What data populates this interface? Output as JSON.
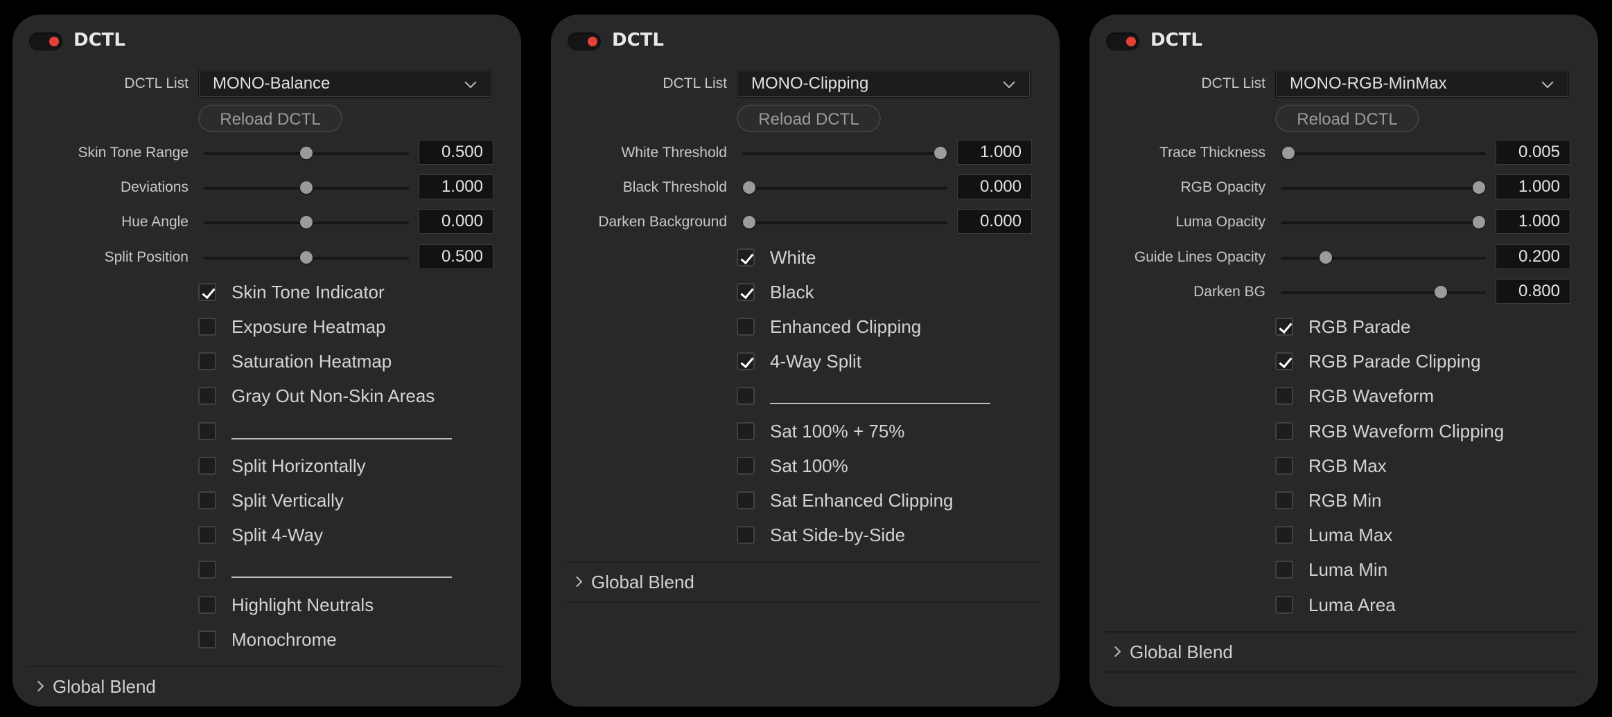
{
  "panels": [
    {
      "title": "DCTL",
      "dctl_list_label": "DCTL List",
      "dctl_list_value": "MONO-Balance",
      "reload_label": "Reload DCTL",
      "sliders": [
        {
          "label": "Skin Tone Range",
          "value": "0.500",
          "position": 0.5
        },
        {
          "label": "Deviations",
          "value": "1.000",
          "position": 0.5
        },
        {
          "label": "Hue Angle",
          "value": "0.000",
          "position": 0.5
        },
        {
          "label": "Split Position",
          "value": "0.500",
          "position": 0.5
        }
      ],
      "checkboxes": [
        {
          "label": "Skin Tone Indicator",
          "checked": true
        },
        {
          "label": "Exposure Heatmap",
          "checked": false
        },
        {
          "label": "Saturation Heatmap",
          "checked": false
        },
        {
          "label": "Gray Out Non-Skin Areas",
          "checked": false
        },
        {
          "label": "",
          "checked": false,
          "separator": true
        },
        {
          "label": "Split Horizontally",
          "checked": false
        },
        {
          "label": "Split Vertically",
          "checked": false
        },
        {
          "label": "Split 4-Way",
          "checked": false
        },
        {
          "label": "",
          "checked": false,
          "separator": true
        },
        {
          "label": "Highlight Neutrals",
          "checked": false
        },
        {
          "label": "Monochrome",
          "checked": false
        }
      ],
      "section_label": "Global Blend"
    },
    {
      "title": "DCTL",
      "dctl_list_label": "DCTL List",
      "dctl_list_value": "MONO-Clipping",
      "reload_label": "Reload DCTL",
      "sliders": [
        {
          "label": "White Threshold",
          "value": "1.000",
          "position": 1.0
        },
        {
          "label": "Black Threshold",
          "value": "0.000",
          "position": 0.0
        },
        {
          "label": "Darken Background",
          "value": "0.000",
          "position": 0.0
        }
      ],
      "checkboxes": [
        {
          "label": "White",
          "checked": true
        },
        {
          "label": "Black",
          "checked": true
        },
        {
          "label": "Enhanced Clipping",
          "checked": false
        },
        {
          "label": "4-Way Split",
          "checked": true
        },
        {
          "label": "",
          "checked": false,
          "separator": true
        },
        {
          "label": "Sat 100% + 75%",
          "checked": false
        },
        {
          "label": "Sat 100%",
          "checked": false
        },
        {
          "label": "Sat Enhanced Clipping",
          "checked": false
        },
        {
          "label": "Sat Side-by-Side",
          "checked": false
        }
      ],
      "section_label": "Global Blend"
    },
    {
      "title": "DCTL",
      "dctl_list_label": "DCTL List",
      "dctl_list_value": "MONO-RGB-MinMax",
      "reload_label": "Reload DCTL",
      "sliders": [
        {
          "label": "Trace Thickness",
          "value": "0.005",
          "position": 0.005
        },
        {
          "label": "RGB Opacity",
          "value": "1.000",
          "position": 1.0
        },
        {
          "label": "Luma Opacity",
          "value": "1.000",
          "position": 1.0
        },
        {
          "label": "Guide Lines Opacity",
          "value": "0.200",
          "position": 0.2
        },
        {
          "label": "Darken BG",
          "value": "0.800",
          "position": 0.8
        }
      ],
      "checkboxes": [
        {
          "label": "RGB Parade",
          "checked": true
        },
        {
          "label": "RGB Parade Clipping",
          "checked": true
        },
        {
          "label": "RGB Waveform",
          "checked": false
        },
        {
          "label": "RGB Waveform Clipping",
          "checked": false
        },
        {
          "label": "RGB Max",
          "checked": false
        },
        {
          "label": "RGB Min",
          "checked": false
        },
        {
          "label": "Luma Max",
          "checked": false
        },
        {
          "label": "Luma Min",
          "checked": false
        },
        {
          "label": "Luma Area",
          "checked": false
        }
      ],
      "section_label": "Global Blend"
    }
  ],
  "colors": {
    "background": "#000000",
    "panel": "#282828",
    "toggle_dot": "#e5403a",
    "field": "#121212",
    "thumb": "#9b9b9b"
  },
  "icons": {
    "toggle": "power-toggle-icon",
    "dropdown": "chevron-down-icon",
    "section": "chevron-right-icon",
    "check": "checkmark-icon"
  }
}
